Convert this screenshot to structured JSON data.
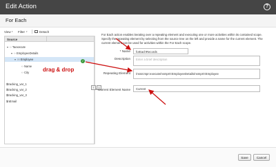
{
  "dialog": {
    "title": "Edit Action",
    "help_icon": "question-icon"
  },
  "header": {
    "title": "For Each"
  },
  "tree_toolbar": {
    "view": "View",
    "filter": "Filter",
    "detach": "Detach"
  },
  "tree": {
    "column_header": "Source",
    "nodes": [
      {
        "label": "Taexecute",
        "level": 0,
        "expanded": true
      },
      {
        "label": "EmployeeDetails",
        "level": 1,
        "expanded": true
      },
      {
        "label": "Employee",
        "level": 2,
        "expanded": true,
        "selected": true
      },
      {
        "label": "Name",
        "level": 3
      },
      {
        "label": "City",
        "level": 3
      },
      {
        "label": "$tracking_var_1",
        "level": 0
      },
      {
        "label": "$tracking_var_2",
        "level": 0
      },
      {
        "label": "$tracking_var_3",
        "level": 0
      },
      {
        "label": "$nEmail",
        "level": 0
      }
    ]
  },
  "description": "For Each action enables iterating over a repeating element and executing one or more activities within its contained scope. Specify the repeating element by selecting from the source tree on the left and provide a name for the current element. The current element can be used for activities within the For Each scope.",
  "form": {
    "name_label": "* Name",
    "name_value": "forEachRecords",
    "description_label": "Description",
    "description_placeholder": "Enter a brief description",
    "repeating_label": "Repeating Element",
    "repeating_value": "/nssrcmpr:execute/nsmpr0:EmployeeDetails/nsmpr0:Employee",
    "current_label": "* Current Element Name",
    "current_value": "Current"
  },
  "annotation": {
    "text": "drag & drop",
    "color": "#cc1111"
  },
  "buttons": {
    "save": "Save",
    "cancel": "Cancel"
  }
}
